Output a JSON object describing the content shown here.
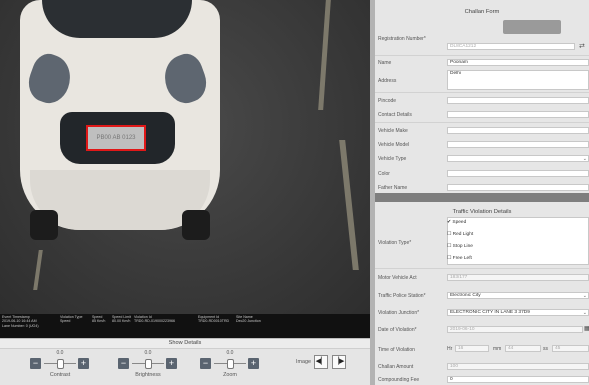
{
  "camera": {
    "plate_text": "PB00 AB 0123",
    "overlay_columns": [
      {
        "head": "Event Timestamp",
        "val": "2019-06-10 16:44 AM",
        "val2": "Lane Number: 0 (UO4)"
      },
      {
        "head": "Violation Type",
        "val": "Speed",
        "val2": ""
      },
      {
        "head": "Speed",
        "val": "85 Km/h",
        "val2": ""
      },
      {
        "head": "Speed Limit",
        "val": "80.00 Km/h",
        "val2": ""
      },
      {
        "head": "Violation Id",
        "val": "TRD0-RD-019000223966",
        "val2": ""
      },
      {
        "head": "Equipment Id",
        "val": "TRD0-RD0010TRD",
        "val2": ""
      },
      {
        "head": "Site Name",
        "val": "Dec20 Junction",
        "val2": ""
      }
    ]
  },
  "controls": {
    "show_details": "Show Details",
    "contrast": {
      "label": "Contrast",
      "value": "0.0"
    },
    "brightness": {
      "label": "Brightness",
      "value": "0.0"
    },
    "zoom": {
      "label": "Zoom",
      "value": "0.0"
    },
    "image_label": "Image",
    "prev_icon": "step-back-icon",
    "next_icon": "step-forward-icon"
  },
  "challan": {
    "title": "Challan Form",
    "registration_label": "Registration Number*",
    "registration_value": "DL8CA1212",
    "name_label": "Name",
    "name_value": "Poonam",
    "address_label": "Address",
    "address_value": "Delhi",
    "pincode_label": "Pincode",
    "contact_label": "Contact Details",
    "make_label": "Vehicle Make",
    "model_label": "Vehicle Model",
    "type_label": "Vehicle Type",
    "color_label": "Color",
    "father_label": "Father Name"
  },
  "violation": {
    "title": "Traffic Violation Details",
    "type_label": "Violation Type*",
    "options": [
      {
        "label": "Speed",
        "checked": true
      },
      {
        "label": "Red Light",
        "checked": false
      },
      {
        "label": "Stop Line",
        "checked": false
      },
      {
        "label": "Free Left",
        "checked": false
      }
    ],
    "act_label": "Motor Vehicle Act",
    "act_value": "183/177",
    "station_label": "Traffic Police Station*",
    "station_value": "Electronic City",
    "junction_label": "Violation Junction*",
    "junction_value": "ELECTRONIC CITY IN LANE 3 37D9",
    "date_label": "Date of Violation*",
    "date_value": "2019-06-10",
    "time_label": "Time of Violation",
    "time_hr_label": "Hr",
    "time_hr_value": "16",
    "time_min_label": "mm",
    "time_min_value": "44",
    "time_ss_label": "ss",
    "time_ss_value": "45",
    "amount_label": "Challan Amount",
    "amount_value": "100",
    "fee_label": "Compounding Fee",
    "fee_value": "0"
  },
  "colors": {
    "accent_red": "#e01818",
    "panel_bg": "#e6e6e6",
    "camera_bg": "#363636"
  }
}
